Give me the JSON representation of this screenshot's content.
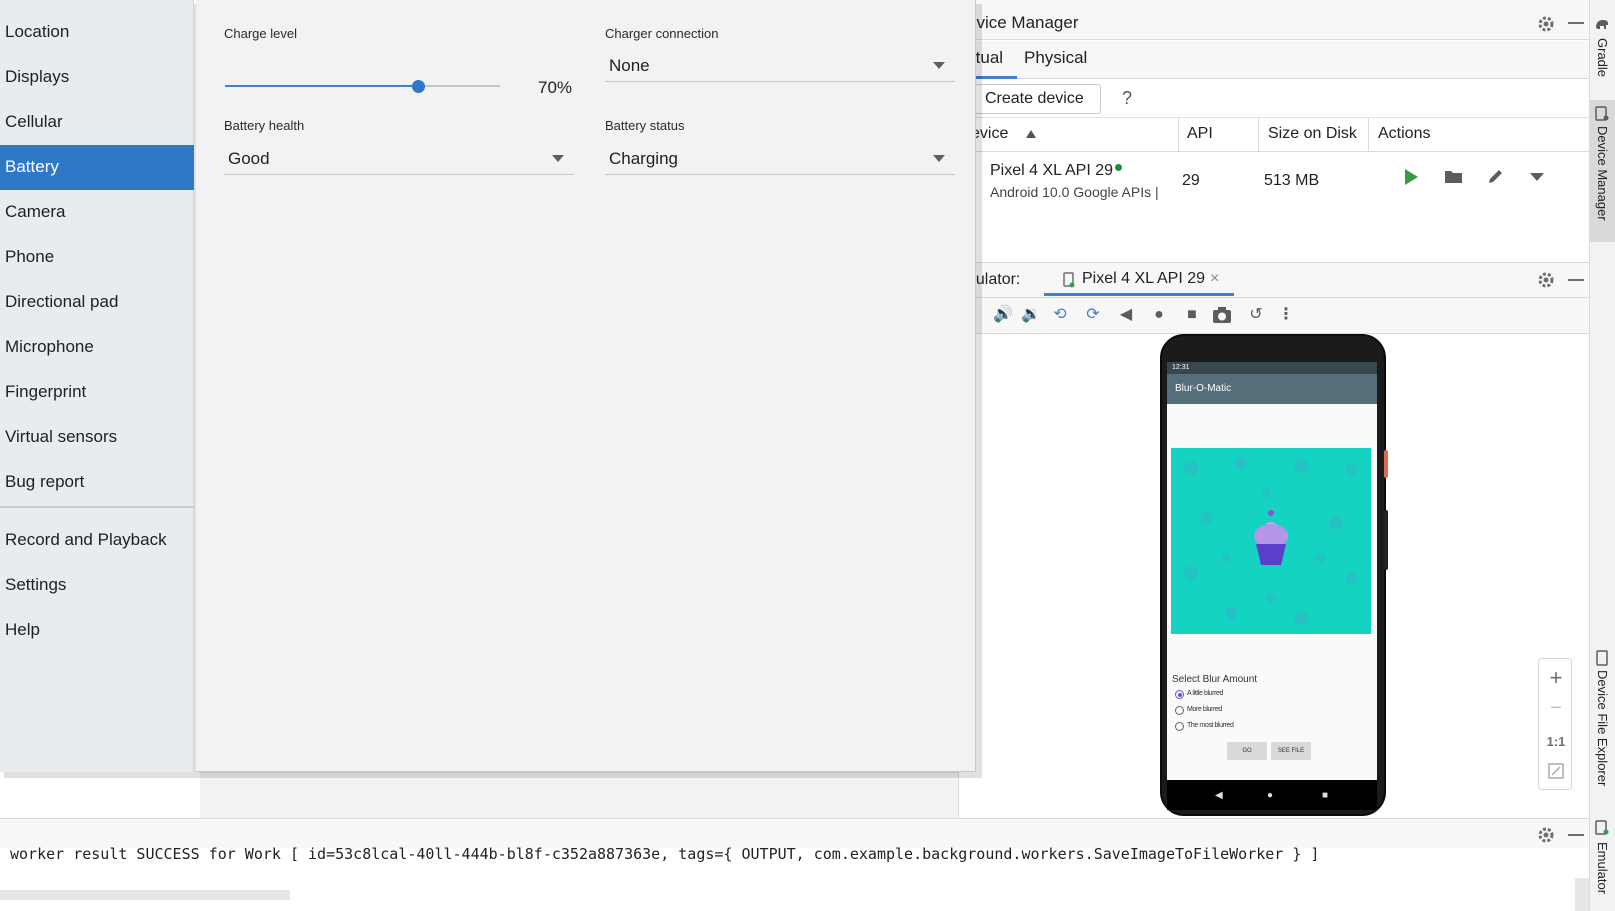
{
  "extended_controls": {
    "nav": [
      {
        "label": "Location",
        "active": false
      },
      {
        "label": "Displays",
        "active": false
      },
      {
        "label": "Cellular",
        "active": false
      },
      {
        "label": "Battery",
        "active": true
      },
      {
        "label": "Camera",
        "active": false
      },
      {
        "label": "Phone",
        "active": false
      },
      {
        "label": "Directional pad",
        "active": false
      },
      {
        "label": "Microphone",
        "active": false
      },
      {
        "label": "Fingerprint",
        "active": false
      },
      {
        "label": "Virtual sensors",
        "active": false
      },
      {
        "label": "Bug report",
        "active": false
      }
    ],
    "nav_bottom": [
      {
        "label": "Record and Playback"
      },
      {
        "label": "Settings"
      },
      {
        "label": "Help"
      }
    ],
    "battery": {
      "charge_level_label": "Charge level",
      "charge_level_value": "70%",
      "charge_level_fraction": 0.7,
      "charger_connection_label": "Charger connection",
      "charger_connection_value": "None",
      "battery_health_label": "Battery health",
      "battery_health_value": "Good",
      "battery_status_label": "Battery status",
      "battery_status_value": "Charging"
    },
    "accent_color": "#2f78c6"
  },
  "device_manager": {
    "title": "evice Manager",
    "tabs": [
      "rtual",
      "Physical"
    ],
    "create_device_label": "Create device",
    "help_label": "?",
    "columns": [
      "evice",
      "API",
      "Size on Disk",
      "Actions"
    ],
    "devices": [
      {
        "name": "Pixel 4 XL API 29",
        "subtitle": "Android 10.0 Google APIs |",
        "api": "29",
        "size": "513 MB",
        "online": true
      }
    ]
  },
  "emulator": {
    "label": "nulator:",
    "tab_label": "Pixel 4 XL API 29",
    "close_icon": "×",
    "zoom": {
      "plus": "+",
      "minus": "−",
      "one_to_one": "1:1"
    },
    "app": {
      "status_time": "12:31",
      "title": "Blur-O-Matic",
      "select_label": "Select Blur Amount",
      "options": [
        {
          "label": "A little blurred",
          "selected": true
        },
        {
          "label": "More blurred",
          "selected": false
        },
        {
          "label": "The most blurred",
          "selected": false
        }
      ],
      "go_label": "GO",
      "see_file_label": "SEE FILE"
    }
  },
  "side_strip": {
    "items": [
      "Gradle",
      "Device Manager",
      "Device File Explorer",
      "Emulator"
    ]
  },
  "logcat": {
    "line": "worker result SUCCESS for Work [ id=53c8lcal-40ll-444b-bl8f-c352a887363e, tags={ OUTPUT, com.example.background.workers.SaveImageToFileWorker } ]"
  },
  "colors": {
    "accent_blue": "#4083c9",
    "run_green": "#3a9a4a",
    "app_teal": "#14d3c1",
    "app_bar": "#546e7a"
  }
}
